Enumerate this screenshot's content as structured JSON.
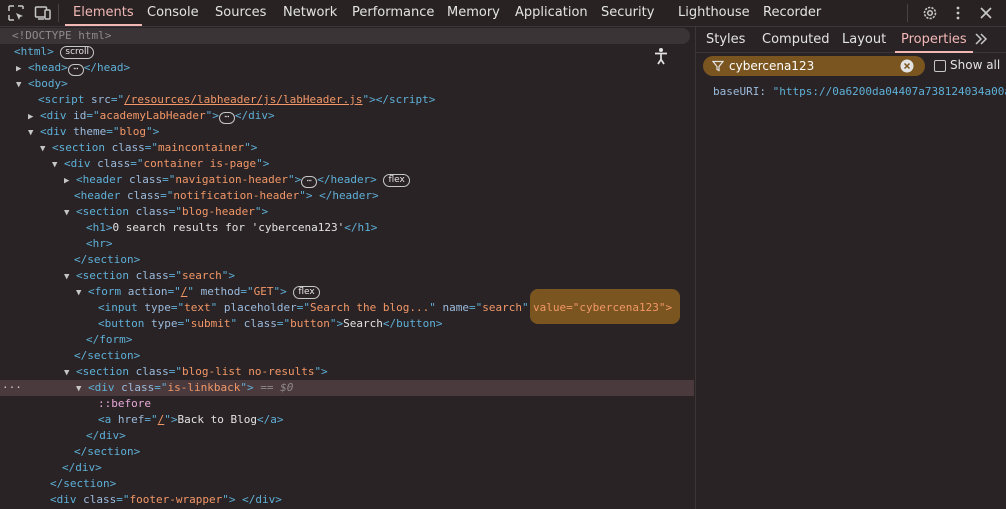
{
  "toolbar": {
    "tabs": [
      "Elements",
      "Console",
      "Sources",
      "Network",
      "Performance",
      "Memory",
      "Application",
      "Security",
      "Lighthouse",
      "Recorder"
    ],
    "active_tab": "Elements"
  },
  "dom": {
    "doctype": "<!DOCTYPE html>",
    "scroll_badge": "scroll",
    "flex_badge": "flex",
    "ellipsis": "⋯",
    "tag_html_open": "<html>",
    "tag_head": "<head>",
    "tag_head_close": "</head>",
    "tag_body": "<body>",
    "script_src_attr": "src",
    "script_src": "/resources/labheader/js/labHeader.js",
    "div_id_value": "academyLabHeader",
    "theme_value": "blog",
    "section_maincontainer": "maincontainer",
    "container_class": "container is-page",
    "nav_header_class": "navigation-header",
    "notification_header_class": "notification-header",
    "blog_header_class": "blog-header",
    "h1_text": "0 search results for 'cybercena123'",
    "search_class": "search",
    "form_action": "/",
    "form_method": "GET",
    "input_type": "text",
    "input_placeholder": "Search the blog...",
    "input_name": "search",
    "input_value_attr": "value=\"cybercena123\">",
    "button_type": "submit",
    "button_class": "button",
    "button_text": "Search",
    "blog_list_class": "blog-list no-results",
    "linkback_class": "is-linkback",
    "selected_marker": "== $0",
    "pseudo_before": "::before",
    "a_href": "/",
    "a_text": "Back to Blog",
    "footer_class": "footer-wrapper"
  },
  "sidebar": {
    "tabs": [
      "Styles",
      "Computed",
      "Layout",
      "Properties"
    ],
    "active_tab": "Properties",
    "filter_value": "cybercena123",
    "show_all_label": "Show all",
    "property_key": "baseURI",
    "property_value": "\"https://0a6200da04407a738124034a00a"
  },
  "colors": {
    "background": "#2a2326",
    "accent": "#f2b8b5",
    "highlight": "#7a5520",
    "tag": "#5db0d7",
    "attr_value": "#f29766"
  }
}
